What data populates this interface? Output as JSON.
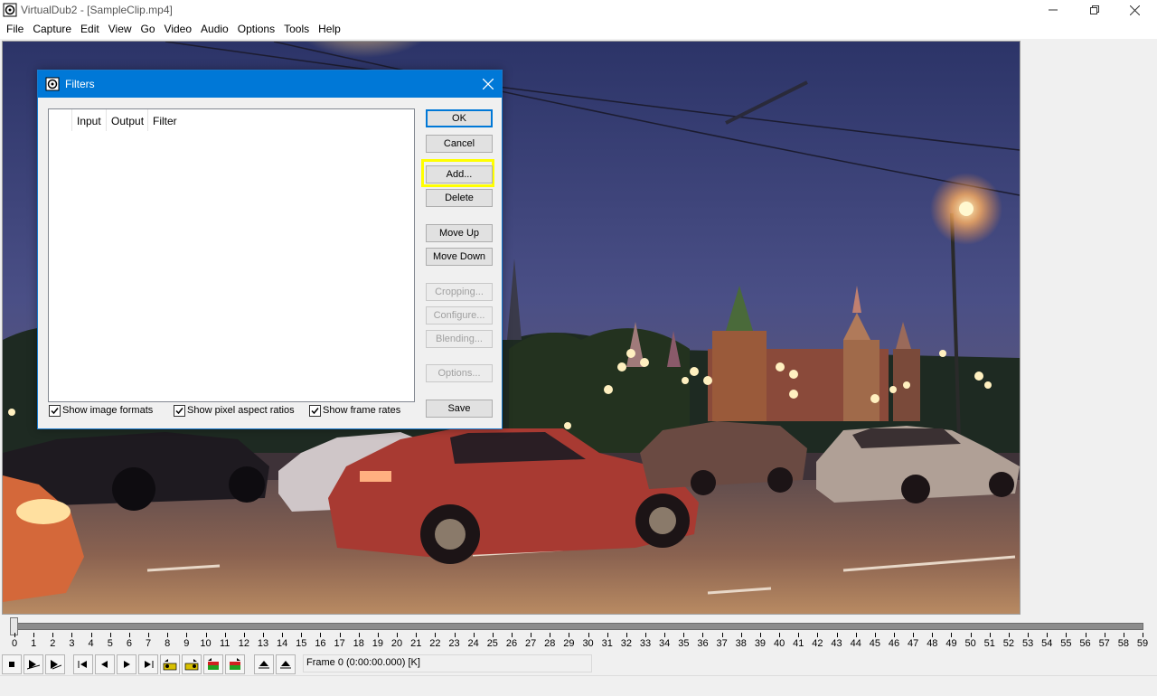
{
  "window": {
    "title": "VirtualDub2 - [SampleClip.mp4]"
  },
  "menu": [
    "File",
    "Capture",
    "Edit",
    "View",
    "Go",
    "Video",
    "Audio",
    "Options",
    "Tools",
    "Help"
  ],
  "dialog": {
    "title": "Filters",
    "columns": [
      "Input",
      "Output",
      "Filter"
    ],
    "buttons": {
      "ok": "OK",
      "cancel": "Cancel",
      "add": "Add...",
      "delete": "Delete",
      "move_up": "Move Up",
      "move_down": "Move Down",
      "cropping": "Cropping...",
      "configure": "Configure...",
      "blending": "Blending...",
      "options": "Options...",
      "save": "Save"
    },
    "checkboxes": [
      {
        "label": "Show image formats",
        "checked": true
      },
      {
        "label": "Show pixel aspect ratios",
        "checked": true
      },
      {
        "label": "Show frame rates",
        "checked": true
      }
    ]
  },
  "timeline": {
    "ticks": [
      "0",
      "1",
      "2",
      "3",
      "4",
      "5",
      "6",
      "7",
      "8",
      "9",
      "10",
      "11",
      "12",
      "13",
      "14",
      "15",
      "16",
      "17",
      "18",
      "19",
      "20",
      "21",
      "22",
      "23",
      "24",
      "25",
      "26",
      "27",
      "28",
      "29",
      "30",
      "31",
      "32",
      "33",
      "34",
      "35",
      "36",
      "37",
      "38",
      "39",
      "40",
      "41",
      "42",
      "43",
      "44",
      "45",
      "46",
      "47",
      "48",
      "49",
      "50",
      "51",
      "52",
      "53",
      "54",
      "55",
      "56",
      "57",
      "58",
      "59"
    ],
    "position_fraction": 0,
    "frame_status": "Frame 0 (0:00:00.000) [K]"
  },
  "toolbar_icons": [
    "stop-icon",
    "play-input-icon",
    "play-output-icon",
    "go-start-icon",
    "prev-frame-icon",
    "next-frame-icon",
    "go-end-icon",
    "prev-keyframe-icon",
    "next-keyframe-icon",
    "prev-scene-icon",
    "next-scene-icon",
    "mark-in-icon",
    "mark-out-icon"
  ]
}
